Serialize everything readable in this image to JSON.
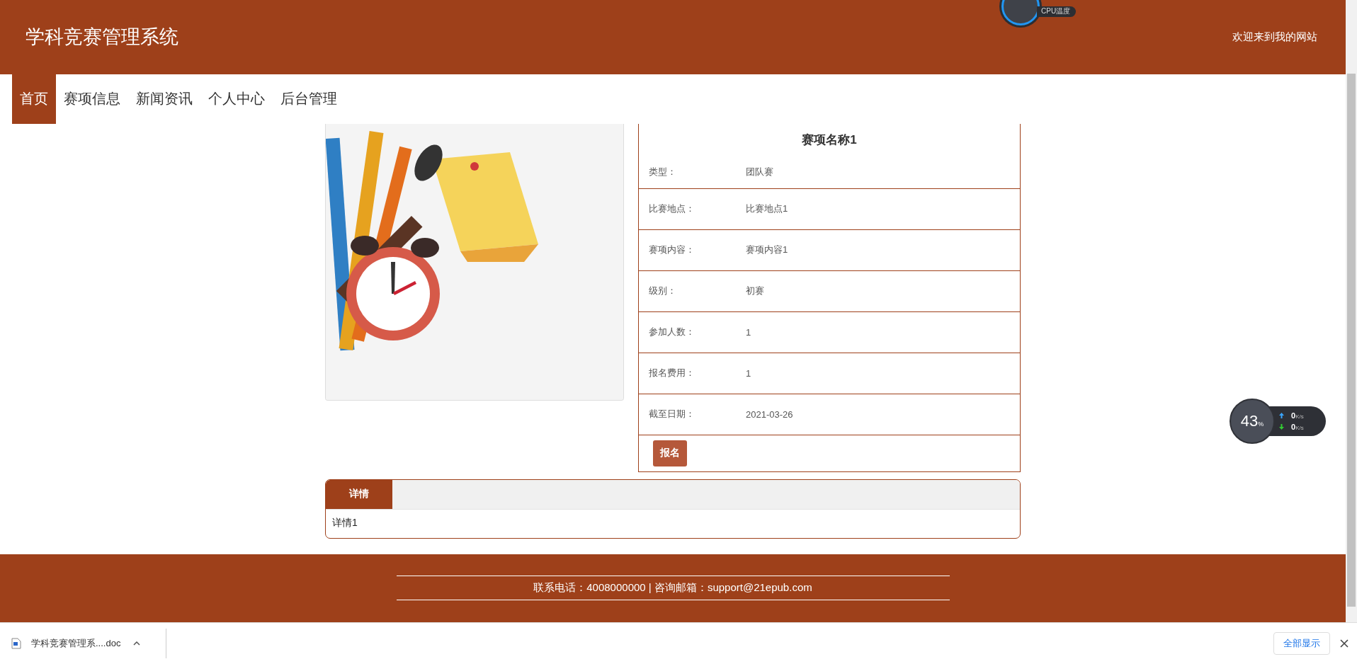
{
  "header": {
    "title": "学科竞赛管理系统",
    "welcome": "欢迎来到我的网站"
  },
  "nav": [
    {
      "label": "首页",
      "selected": true
    },
    {
      "label": "赛项信息",
      "selected": false
    },
    {
      "label": "新闻资讯",
      "selected": false
    },
    {
      "label": "个人中心",
      "selected": false
    },
    {
      "label": "后台管理",
      "selected": false
    }
  ],
  "competition": {
    "title": "赛项名称1",
    "fields": [
      {
        "label": "类型：",
        "value": "团队赛"
      },
      {
        "label": "比赛地点：",
        "value": "比赛地点1"
      },
      {
        "label": "赛项内容：",
        "value": "赛项内容1"
      },
      {
        "label": "级别：",
        "value": "初赛"
      },
      {
        "label": "参加人数：",
        "value": "1"
      },
      {
        "label": "报名费用：",
        "value": "1"
      },
      {
        "label": "截至日期：",
        "value": "2021-03-26"
      }
    ],
    "button": "报名"
  },
  "details": {
    "tabs": [
      {
        "label": "详情",
        "selected": true
      }
    ],
    "content": "详情1"
  },
  "footer": {
    "contact": "联系电话：4008000000 | 咨询邮箱：support@21epub.com"
  },
  "download_bar": {
    "file": "学科竞赛管理系....doc",
    "show_all": "全部显示"
  },
  "widgets": {
    "cpu_label": "CPU温度",
    "net_percent": "43",
    "percent_sign": "%",
    "upload": {
      "value": "0",
      "unit": "K/s"
    },
    "download": {
      "value": "0",
      "unit": "K/s"
    }
  }
}
